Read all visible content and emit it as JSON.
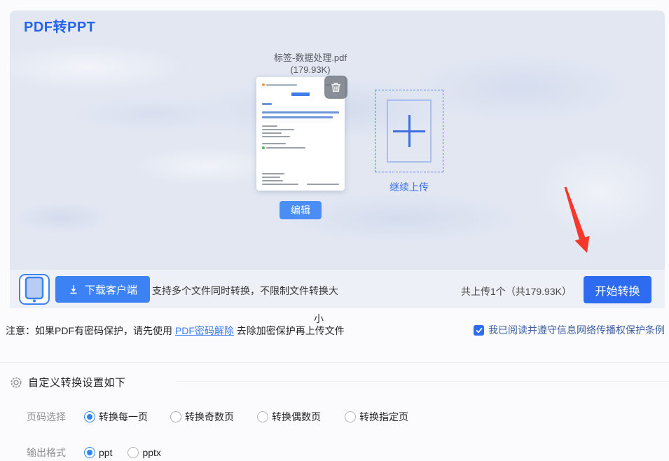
{
  "header": {
    "title": "PDF转PPT"
  },
  "file": {
    "name": "标签-数据处理.pdf",
    "size": "(179.93K)",
    "edit_label": "编辑",
    "continue_upload_label": "继续上传"
  },
  "action_bar": {
    "download_client_label": "下载客户端",
    "support_text_line1": "支持多个文件同时转换，不限制文件转换大",
    "support_text_line2": "小",
    "upload_summary": "共上传1个（共179.93K）",
    "start_convert_label": "开始转换"
  },
  "notice": {
    "prefix": "注意：如果PDF有密码保护，请先使用 ",
    "link_label": "PDF密码解除",
    "suffix": " 去除加密保护再上传文件"
  },
  "agreement": {
    "label": "我已阅读并遵守信息网络传播权保护条例",
    "checked": true
  },
  "settings": {
    "header": "自定义转换设置如下",
    "rows": [
      {
        "label": "页码选择",
        "options": [
          {
            "label": "转换每一页",
            "selected": true
          },
          {
            "label": "转换奇数页",
            "selected": false
          },
          {
            "label": "转换偶数页",
            "selected": false
          },
          {
            "label": "转换指定页",
            "selected": false
          }
        ]
      },
      {
        "label": "输出格式",
        "options": [
          {
            "label": "ppt",
            "selected": true
          },
          {
            "label": "pptx",
            "selected": false
          }
        ]
      }
    ]
  },
  "colors": {
    "accent_blue": "#2d6cf0",
    "panel_bg": "#e2e7f2",
    "bar_bg": "#edf0f6",
    "link_blue": "#3a7bf0",
    "arrow_red": "#f6382b",
    "agreement_text": "#3f5fa0"
  }
}
